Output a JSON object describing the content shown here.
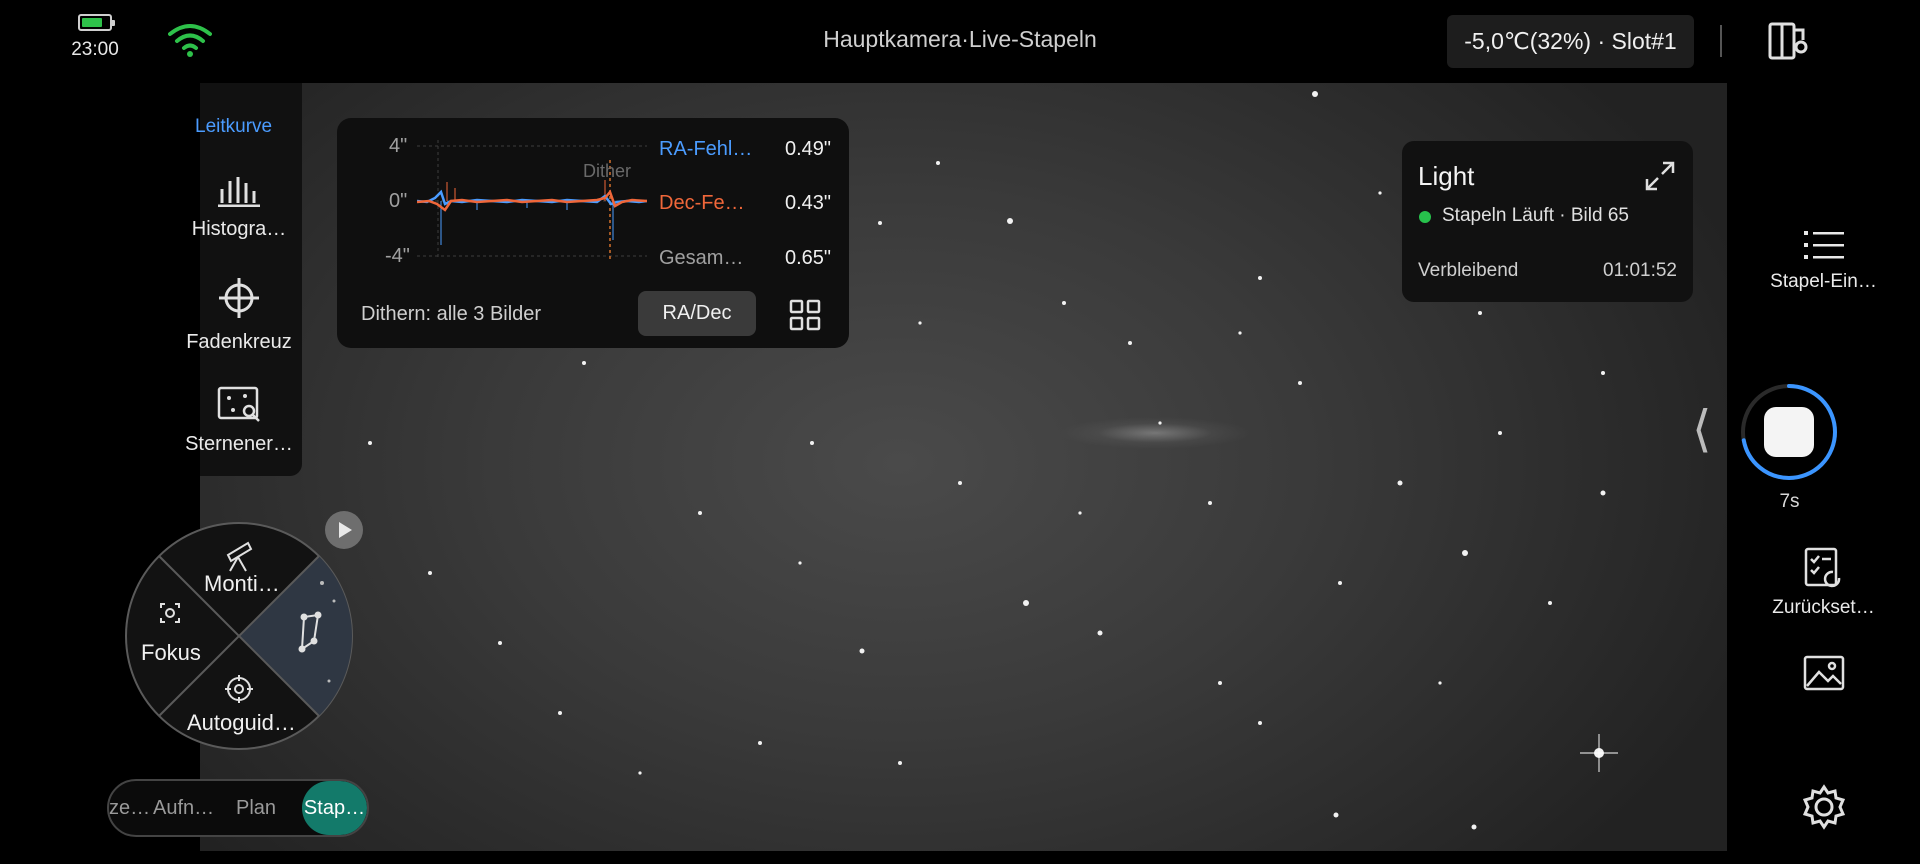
{
  "status": {
    "time": "23:00",
    "battery_level": 0.78
  },
  "header": {
    "title": "Hauptkamera·Live-Stapeln",
    "temperature_slot": "-5,0℃(32%) · Slot#1"
  },
  "tools": {
    "tab_label": "Leitkurve",
    "items": [
      {
        "label": "Histogra…",
        "icon": "histogram-icon"
      },
      {
        "label": "Fadenkreuz",
        "icon": "crosshair-icon"
      },
      {
        "label": "Sternener…",
        "icon": "star-detection-icon"
      }
    ]
  },
  "guide": {
    "y_ticks": [
      "4\"",
      "0\"",
      "-4\""
    ],
    "dither_marker": "Dither",
    "rows": [
      {
        "label": "RA-Fehl…",
        "value": "0.49\"",
        "color": "#4b9cff"
      },
      {
        "label": "Dec-Fe…",
        "value": "0.43\"",
        "color": "#f0673a"
      },
      {
        "label": "Gesam…",
        "value": "0.65\"",
        "color": "#a0a0a0"
      }
    ],
    "dither_text": "Dithern: alle 3 Bilder",
    "mode_button": "RA/Dec"
  },
  "light": {
    "title": "Light",
    "status": "Stapeln Läuft · Bild 65",
    "status_color": "#27c24c",
    "remaining_label": "Verbleibend",
    "remaining_value": "01:01:52"
  },
  "right": {
    "stack_settings": "Stapel-Ein…",
    "exposure_time": "7s",
    "exposure_progress": 0.72,
    "reset": "Zurückset…"
  },
  "radial": {
    "mount": "Monti…",
    "focus": "Fokus",
    "autoguide": "Autoguid…"
  },
  "modes": [
    {
      "label": "ze…"
    },
    {
      "label": "Aufn…"
    },
    {
      "label": "Plan"
    },
    {
      "label": "Stap…",
      "active": true
    }
  ]
}
